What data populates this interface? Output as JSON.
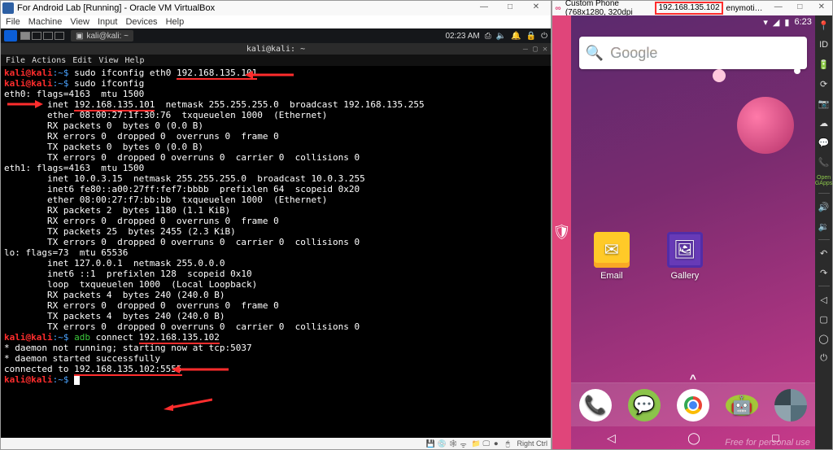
{
  "vbox": {
    "title": "For Android Lab [Running] - Oracle VM VirtualBox",
    "menu": [
      "File",
      "Machine",
      "View",
      "Input",
      "Devices",
      "Help"
    ],
    "status_key": "Right Ctrl"
  },
  "kali": {
    "taskbar_item": "kali@kali: ~",
    "clock": "02:23 AM"
  },
  "terminal": {
    "title": "kali@kali: ~",
    "menu": [
      "File",
      "Actions",
      "Edit",
      "View",
      "Help"
    ],
    "lines": [
      {
        "prompt": true,
        "user": "kali@kali",
        "cmd": "sudo ifconfig eth0 ",
        "arg_ul": "192.168.135.101"
      },
      {
        "prompt": true,
        "user": "kali@kali",
        "cmd": "sudo ifconfig"
      },
      {
        "raw": "eth0: flags=4163<UP,BROADCAST,RUNNING,MULTICAST>  mtu 1500"
      },
      {
        "raw": "        ",
        "pre": "inet ",
        "ul": "192.168.135.101",
        "post": "  netmask 255.255.255.0  broadcast 192.168.135.255",
        "inet_arrow": true
      },
      {
        "raw": "        ether 08:00:27:1f:30:76  txqueuelen 1000  (Ethernet)"
      },
      {
        "raw": "        RX packets 0  bytes 0 (0.0 B)"
      },
      {
        "raw": "        RX errors 0  dropped 0  overruns 0  frame 0"
      },
      {
        "raw": "        TX packets 0  bytes 0 (0.0 B)"
      },
      {
        "raw": "        TX errors 0  dropped 0 overruns 0  carrier 0  collisions 0"
      },
      {
        "raw": ""
      },
      {
        "raw": "eth1: flags=4163<UP,BROADCAST,RUNNING,MULTICAST>  mtu 1500"
      },
      {
        "raw": "        inet 10.0.3.15  netmask 255.255.255.0  broadcast 10.0.3.255"
      },
      {
        "raw": "        inet6 fe80::a00:27ff:fef7:bbbb  prefixlen 64  scopeid 0x20<link>"
      },
      {
        "raw": "        ether 08:00:27:f7:bb:bb  txqueuelen 1000  (Ethernet)"
      },
      {
        "raw": "        RX packets 2  bytes 1180 (1.1 KiB)"
      },
      {
        "raw": "        RX errors 0  dropped 0  overruns 0  frame 0"
      },
      {
        "raw": "        TX packets 25  bytes 2455 (2.3 KiB)"
      },
      {
        "raw": "        TX errors 0  dropped 0 overruns 0  carrier 0  collisions 0"
      },
      {
        "raw": ""
      },
      {
        "raw": "lo: flags=73<UP,LOOPBACK,RUNNING>  mtu 65536"
      },
      {
        "raw": "        inet 127.0.0.1  netmask 255.0.0.0"
      },
      {
        "raw": "        inet6 ::1  prefixlen 128  scopeid 0x10<host>"
      },
      {
        "raw": "        loop  txqueuelen 1000  (Local Loopback)"
      },
      {
        "raw": "        RX packets 4  bytes 240 (240.0 B)"
      },
      {
        "raw": "        RX errors 0  dropped 0  overruns 0  frame 0"
      },
      {
        "raw": "        TX packets 4  bytes 240 (240.0 B)"
      },
      {
        "raw": "        TX errors 0  dropped 0 overruns 0  carrier 0  collisions 0"
      },
      {
        "raw": ""
      },
      {
        "prompt": true,
        "user": "kali@kali",
        "cmd_green": "adb",
        "cmd": " connect ",
        "arg_ul": "192.168.135.102"
      },
      {
        "raw": "* daemon not running; starting now at tcp:5037"
      },
      {
        "raw": "* daemon started successfully"
      },
      {
        "raw": "connected to ",
        "ul": "192.168.135.102:5555"
      },
      {
        "prompt": true,
        "user": "kali@kali",
        "cursor": true
      }
    ]
  },
  "geny": {
    "title_prefix": "Custom Phone (768x1280, 320dpi",
    "ip": "192.168.135.102",
    "title_suffix": "enymoti…",
    "toolbar": [
      "gps-icon",
      "id-icon",
      "battery-icon",
      "rotate-icon",
      "camera-icon",
      "sms-icon",
      "phone-icon",
      "opengapps",
      "sep",
      "volume-up-icon",
      "volume-down-icon",
      "sep",
      "rotate-left-icon",
      "rotate-right-icon",
      "sep",
      "back-icon",
      "menu-icon",
      "home-icon",
      "power-icon"
    ]
  },
  "android": {
    "clock": "6:23",
    "search_placeholder": "Google",
    "apps": {
      "email": "Email",
      "gallery": "Gallery"
    },
    "watermark": "Free for personal use"
  }
}
